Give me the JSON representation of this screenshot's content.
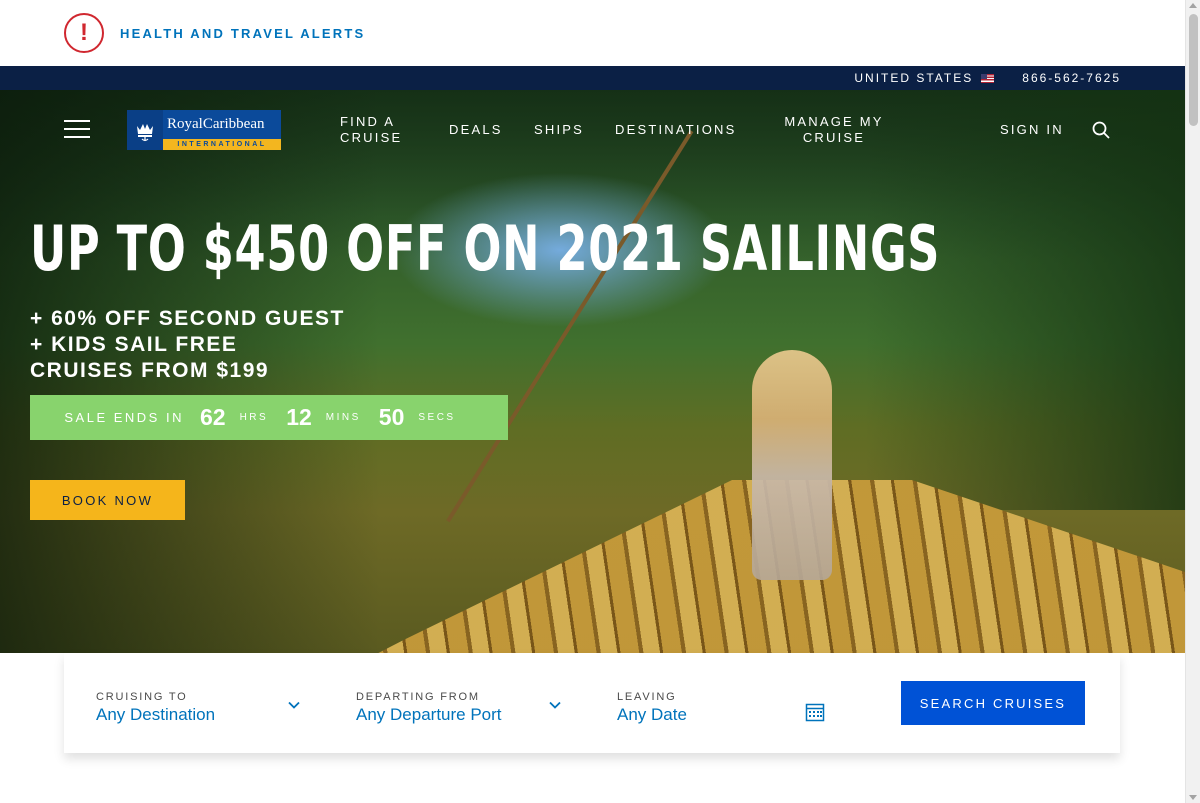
{
  "alert": {
    "text": "HEALTH AND TRAVEL ALERTS",
    "icon": "exclamation-icon"
  },
  "utility": {
    "country": "UNITED STATES",
    "phone": "866-562-7625"
  },
  "nav": {
    "logo_brand": "RoyalCaribbean",
    "logo_sub": "INTERNATIONAL",
    "find_a_cruise": "FIND A CRUISE",
    "deals": "DEALS",
    "ships": "SHIPS",
    "destinations": "DESTINATIONS",
    "manage_my_cruise": "MANAGE MY CRUISE",
    "sign_in": "SIGN IN"
  },
  "hero": {
    "headline": "UP TO $450 OFF ON 2021 SAILINGS",
    "line1": "+ 60% OFF SECOND GUEST",
    "line2": "+ KIDS SAIL FREE",
    "line3": "CRUISES FROM $199",
    "countdown": {
      "label": "SALE ENDS IN",
      "hours": "62",
      "hours_unit": "HRS",
      "mins": "12",
      "mins_unit": "MINS",
      "secs": "50",
      "secs_unit": "SECS"
    },
    "cta": "BOOK NOW"
  },
  "search": {
    "destination_label": "CRUISING TO",
    "destination_value": "Any Destination",
    "port_label": "DEPARTING FROM",
    "port_value": "Any Departure Port",
    "date_label": "LEAVING",
    "date_value": "Any Date",
    "button": "SEARCH CRUISES"
  },
  "colors": {
    "alert_red": "#d0272f",
    "link_blue": "#0073bb",
    "navy": "#0b2045",
    "countdown_green": "#88d36d",
    "cta_yellow": "#f5b51b",
    "search_blue": "#0052d6"
  }
}
